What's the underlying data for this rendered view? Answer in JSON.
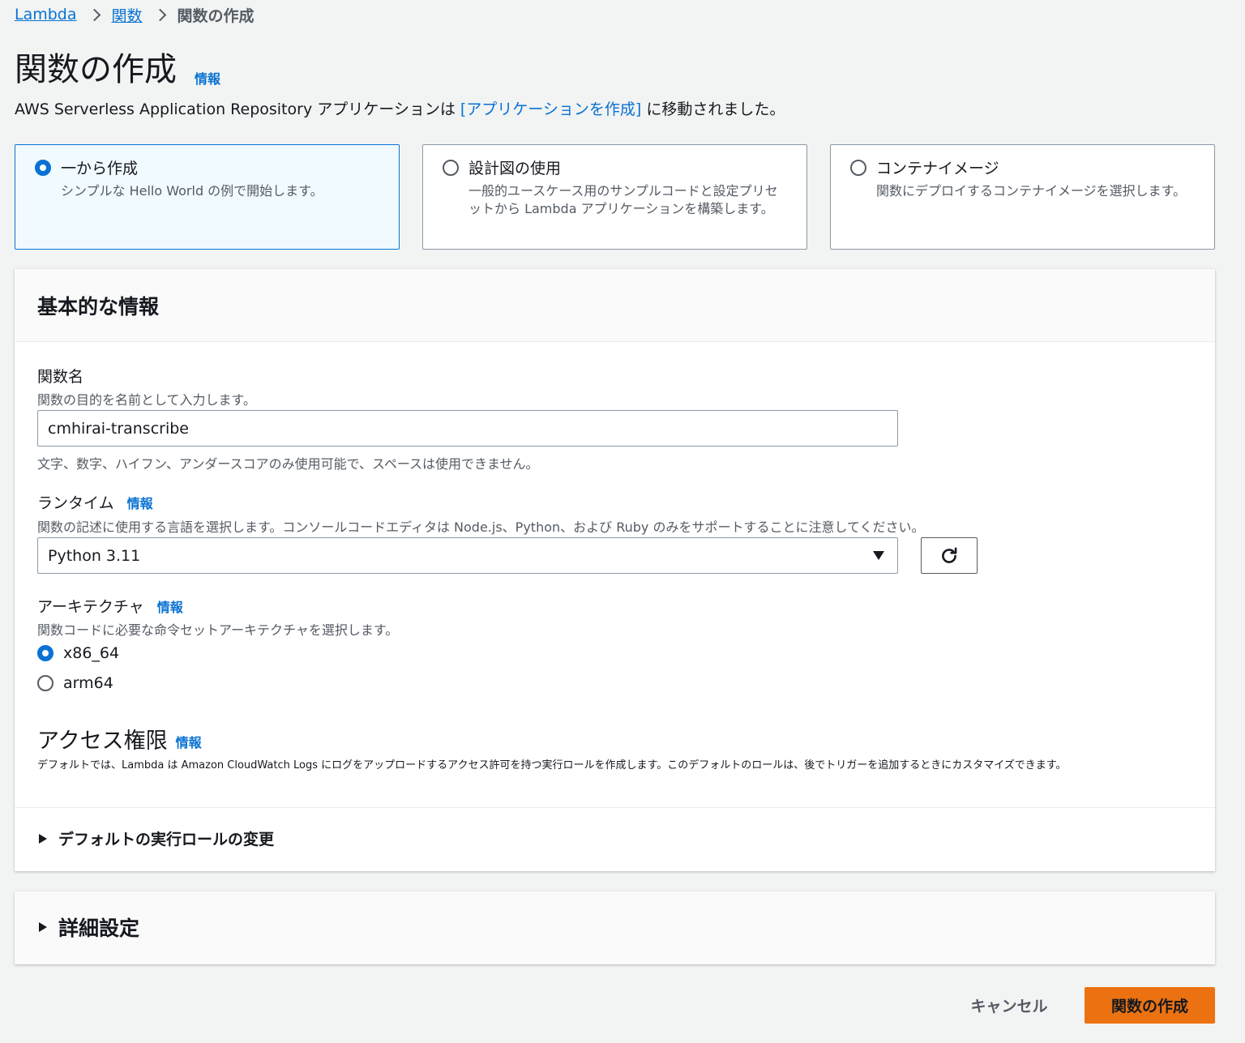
{
  "breadcrumb": {
    "item1": "Lambda",
    "item2": "関数",
    "current": "関数の作成"
  },
  "header": {
    "title": "関数の作成",
    "info": "情報",
    "notice_before": "AWS Serverless Application Repository アプリケーションは ",
    "notice_link": "[アプリケーションを作成]",
    "notice_after": " に移動されました。"
  },
  "options": [
    {
      "title": "一から作成",
      "desc": "シンプルな Hello World の例で開始します。",
      "selected": true
    },
    {
      "title": "設計図の使用",
      "desc": "一般的ユースケース用のサンプルコードと設定プリセットから Lambda アプリケーションを構築します。",
      "selected": false
    },
    {
      "title": "コンテナイメージ",
      "desc": "関数にデプロイするコンテナイメージを選択します。",
      "selected": false
    }
  ],
  "basic": {
    "title": "基本的な情報",
    "function_name_label": "関数名",
    "function_name_desc": "関数の目的を名前として入力します。",
    "function_name_value": "cmhirai-transcribe",
    "function_name_constraint": "文字、数字、ハイフン、アンダースコアのみ使用可能で、スペースは使用できません。",
    "runtime_label": "ランタイム",
    "runtime_info": "情報",
    "runtime_desc": "関数の記述に使用する言語を選択します。コンソールコードエディタは Node.js、Python、および Ruby のみをサポートすることに注意してください。",
    "runtime_value": "Python 3.11",
    "arch_label": "アーキテクチャ",
    "arch_info": "情報",
    "arch_desc": "関数コードに必要な命令セットアーキテクチャを選択します。",
    "arch_options": [
      {
        "label": "x86_64",
        "selected": true
      },
      {
        "label": "arm64",
        "selected": false
      }
    ],
    "access_title": "アクセス権限",
    "access_info": "情報",
    "access_desc": "デフォルトでは、Lambda は Amazon CloudWatch Logs にログをアップロードするアクセス許可を持つ実行ロールを作成します。このデフォルトのロールは、後でトリガーを追加するときにカスタマイズできます。",
    "role_expander": "デフォルトの実行ロールの変更"
  },
  "advanced": {
    "title": "詳細設定"
  },
  "footer": {
    "cancel": "キャンセル",
    "create": "関数の作成"
  }
}
